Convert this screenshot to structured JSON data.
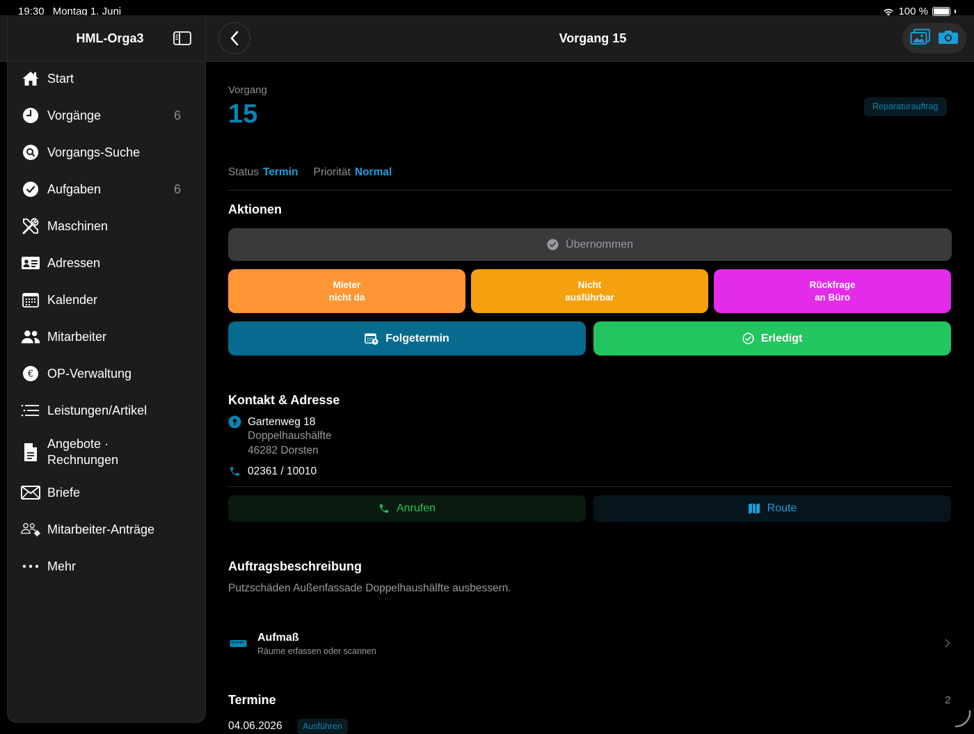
{
  "status_bar": {
    "time": "19:30",
    "date": "Montag 1. Juni",
    "battery": "100 %"
  },
  "sidebar": {
    "app_title": "HML-Orga3",
    "items": [
      {
        "label": "Start",
        "badge": "",
        "icon": "house-icon"
      },
      {
        "label": "Vorgänge",
        "badge": "6",
        "icon": "clock-icon"
      },
      {
        "label": "Vorgangs-Suche",
        "badge": "",
        "icon": "search-icon"
      },
      {
        "label": "Aufgaben",
        "badge": "6",
        "icon": "checkmark-circle-icon"
      },
      {
        "label": "Maschinen",
        "badge": "",
        "icon": "tools-icon"
      },
      {
        "label": "Adressen",
        "badge": "",
        "icon": "contact-card-icon"
      },
      {
        "label": "Kalender",
        "badge": "",
        "icon": "calendar-icon"
      },
      {
        "label": "Mitarbeiter",
        "badge": "",
        "icon": "people-icon"
      },
      {
        "label": "OP-Verwaltung",
        "badge": "",
        "icon": "euro-icon"
      },
      {
        "label": "Leistungen/Artikel",
        "badge": "",
        "icon": "list-icon"
      },
      {
        "label": "Angebote ·",
        "label2": "Rechnungen",
        "badge": "",
        "icon": "document-icon"
      },
      {
        "label": "Briefe",
        "badge": "",
        "icon": "envelope-icon"
      },
      {
        "label": "Mitarbeiter-Anträge",
        "badge": "",
        "icon": "people-gear-icon"
      },
      {
        "label": "Mehr",
        "badge": "",
        "icon": "more-dots-icon"
      }
    ]
  },
  "header": {
    "title": "Vorgang 15"
  },
  "vorgang": {
    "kicker": "Vorgang",
    "number": "15",
    "type": "Reparaturauftrag",
    "status_label": "Status",
    "status_value": "Termin",
    "priority_label": "Priorität",
    "priority_value": "Normal"
  },
  "actions": {
    "heading": "Aktionen",
    "taken_label": "Übernommen",
    "status_buttons": [
      {
        "line1": "Mieter",
        "line2": "nicht da",
        "color": "#ff9533"
      },
      {
        "line1": "Nicht",
        "line2": "ausführbar",
        "color": "#f5a00f"
      },
      {
        "line1": "Rückfrage",
        "line2": "an Büro",
        "color": "#e52bea"
      }
    ],
    "followup_label": "Folgetermin",
    "followup_color": "#066b8f",
    "done_label": "Erledigt",
    "done_color": "#22c55e"
  },
  "contact": {
    "heading": "Kontakt & Adresse",
    "street": "Gartenweg 18",
    "line2": "Doppelhaushälfte",
    "city": "46282 Dorsten",
    "phone": "02361 / 10010",
    "call_label": "Anrufen",
    "route_label": "Route"
  },
  "description": {
    "heading": "Auftragsbeschreibung",
    "text": "Putzschäden Außenfassade Doppelhaushälfte ausbessern."
  },
  "aufmass": {
    "title": "Aufmaß",
    "subtitle": "Räume erfassen oder scannen"
  },
  "termine": {
    "heading": "Termine",
    "count": "2",
    "first_date": "04.06.2026",
    "first_tag": "Ausführen"
  }
}
